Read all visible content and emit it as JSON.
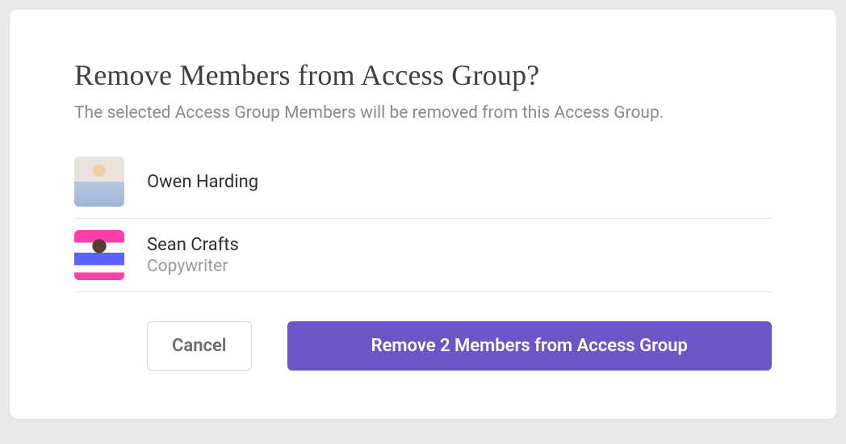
{
  "modal": {
    "title": "Remove Members from Access Group?",
    "subtitle": "The selected Access Group Members will be removed from this Access Group.",
    "members": [
      {
        "name": "Owen Harding",
        "subtitle": ""
      },
      {
        "name": "Sean Crafts",
        "subtitle": "Copywriter"
      }
    ],
    "buttons": {
      "cancel": "Cancel",
      "confirm": "Remove 2 Members from Access Group"
    }
  },
  "colors": {
    "primary": "#6c55c6"
  }
}
